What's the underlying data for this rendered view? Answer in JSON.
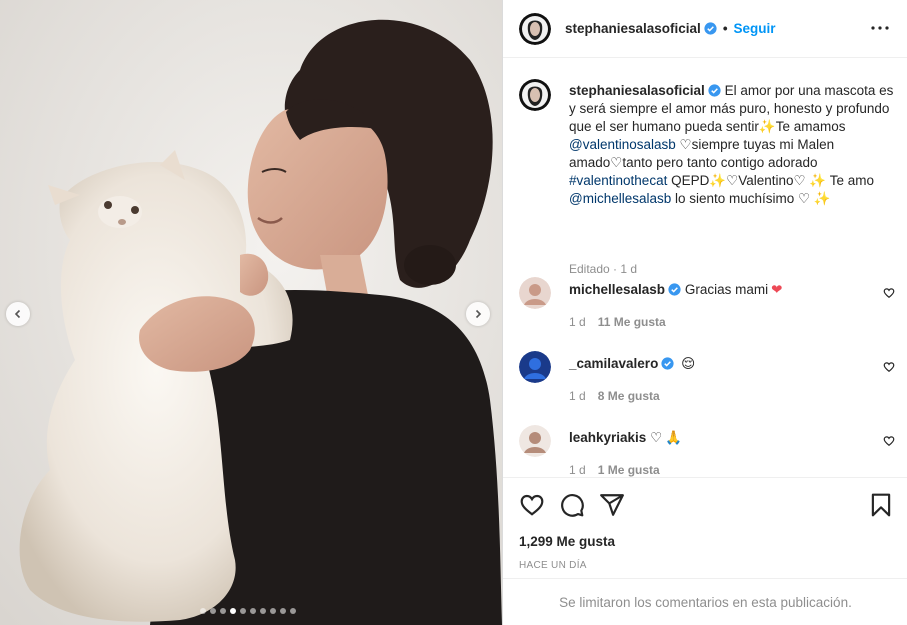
{
  "post": {
    "username": "stephaniesalasoficial",
    "bullet": "•",
    "follow_label": "Seguir",
    "more_icon": "more-horizontal-icon"
  },
  "caption": {
    "username": "stephaniesalasoficial",
    "segments": [
      {
        "text": " El amor por una mascota es y será siempre el amor más puro, honesto y profundo que el ser humano pueda sentir",
        "type": "text"
      },
      {
        "text": "✨",
        "type": "emoji"
      },
      {
        "text": "Te amamos ",
        "type": "text"
      },
      {
        "text": "@valentinosalasb",
        "type": "mention"
      },
      {
        "text": " ♡",
        "type": "text"
      },
      {
        "text": "siempre tuyas mi Malen amado",
        "type": "text"
      },
      {
        "text": "♡",
        "type": "text"
      },
      {
        "text": "tanto pero tanto contigo adorado ",
        "type": "text"
      },
      {
        "text": "#valentinothecat",
        "type": "hashtag"
      },
      {
        "text": " QEPD",
        "type": "text"
      },
      {
        "text": "✨",
        "type": "emoji"
      },
      {
        "text": "♡Valentino♡ ",
        "type": "text"
      },
      {
        "text": "✨",
        "type": "emoji"
      },
      {
        "text": " Te amo ",
        "type": "text"
      },
      {
        "text": "@michellesalasb",
        "type": "mention"
      },
      {
        "text": " lo siento muchísimo ♡ ",
        "type": "text"
      },
      {
        "text": "✨",
        "type": "emoji"
      }
    ],
    "meta": "Editado · 1 d"
  },
  "comments": [
    {
      "username": "michellesalasb",
      "verified": true,
      "text": "Gracias mami",
      "emoji": "❤",
      "age": "1 d",
      "likes": "11 Me gusta"
    },
    {
      "username": "_camilavalero",
      "verified": true,
      "text": "",
      "emoji": "😌",
      "age": "1 d",
      "likes": "8 Me gusta"
    },
    {
      "username": "leahkyriakis",
      "verified": false,
      "text": "♡",
      "emoji": "🙏",
      "age": "1 d",
      "likes": "1 Me gusta"
    }
  ],
  "actions": {
    "like_icon": "heart-icon",
    "comment_icon": "comment-icon",
    "share_icon": "share-icon",
    "save_icon": "bookmark-icon",
    "likes_count": "1,299 Me gusta",
    "time_ago": "HACE UN DÍA"
  },
  "comments_disabled_text": "Se limitaron los comentarios en esta publicación.",
  "carousel": {
    "total_slides": 10,
    "active_index": 3
  },
  "colors": {
    "accent": "#0095f6",
    "link": "#00376b",
    "muted": "#8e8e8e",
    "verified": "#3897f0",
    "heart_red": "#ed4956"
  }
}
